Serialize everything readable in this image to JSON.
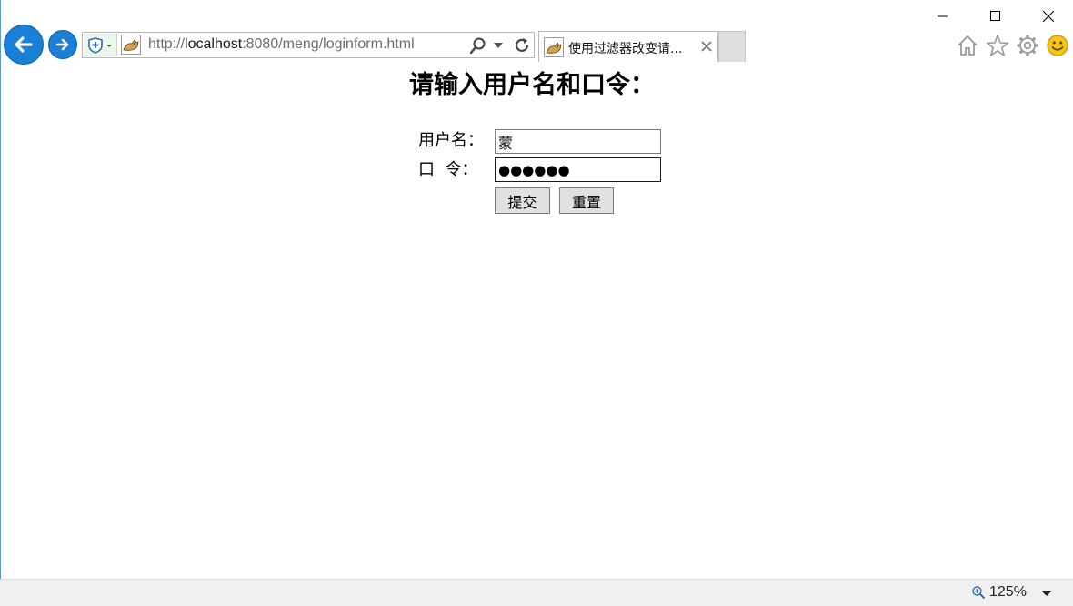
{
  "browser": {
    "address": {
      "scheme": "http://",
      "host": "localhost",
      "rest": ":8080/meng/loginform.html"
    },
    "tab": {
      "title": "使用过滤器改变请..."
    },
    "status": {
      "zoom_level": "125%"
    },
    "icons": {
      "back": "back-arrow-icon",
      "forward": "forward-arrow-icon",
      "security": "shield-icon",
      "favicon": "tomcat-icon",
      "search": "search-icon",
      "refresh": "refresh-icon",
      "close_tab": "close-icon",
      "home": "home-icon",
      "favorites": "star-icon",
      "tools": "gear-icon",
      "feedback": "smiley-icon",
      "zoom": "magnifier-icon"
    },
    "colors": {
      "nav_button": "#1a7fd6",
      "window_edge": "#5b9bd5"
    }
  },
  "page": {
    "heading": "请输入用户名和口令：",
    "form": {
      "username_label": "用户名：",
      "password_label": "口  令：",
      "username_value": "蒙",
      "password_value": "●●●●●●",
      "submit_label": "提交",
      "reset_label": "重置"
    }
  }
}
